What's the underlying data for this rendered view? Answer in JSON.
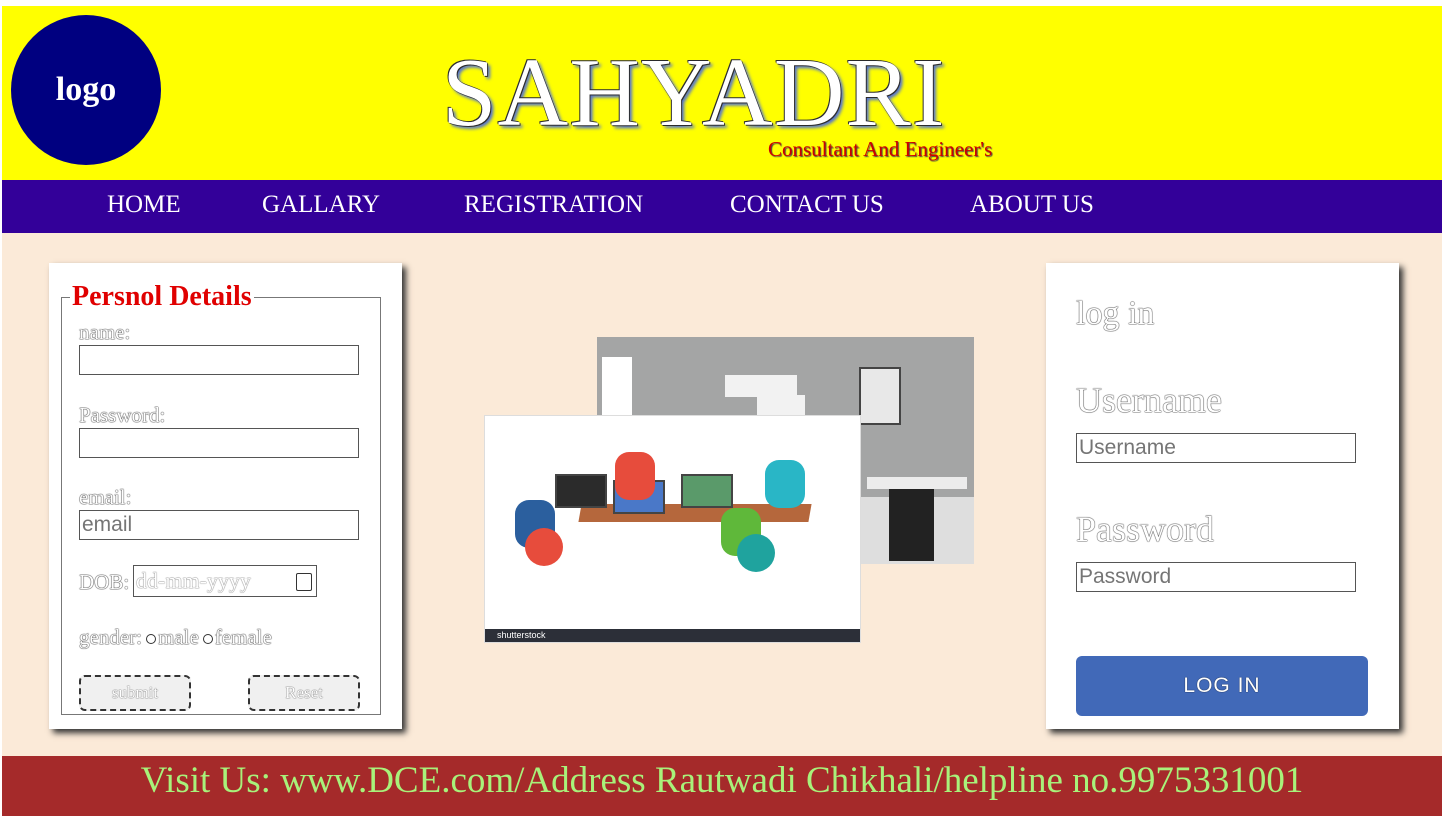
{
  "header": {
    "logo_text": "logo",
    "brand": "SAHYADRI",
    "tagline": "Consultant And Engineer's"
  },
  "nav": {
    "items": [
      "HOME",
      "GALLARY",
      "REGISTRATION",
      "CONTACT US",
      "ABOUT US"
    ]
  },
  "registration": {
    "legend": "Persnol Details",
    "name_label": "name:",
    "name_value": "",
    "password_label": "Password:",
    "password_value": "",
    "email_label": "email:",
    "email_placeholder": "email",
    "dob_label": "DOB:",
    "dob_placeholder": "dd-mm-yyyy",
    "gender_label": "gender:",
    "gender_options": [
      "male",
      "female"
    ],
    "submit_label": "submit",
    "reset_label": "Reset"
  },
  "gallery": {
    "team_image_caption": "shutterstock"
  },
  "login": {
    "title": "log in",
    "username_label": "Username",
    "username_placeholder": "Username",
    "password_label": "Password",
    "password_placeholder": "Password",
    "button_label": "LOG IN"
  },
  "footer": {
    "text": "Visit Us: www.DCE.com/Address Rautwadi Chikhali/helpline no.9975331001"
  },
  "colors": {
    "header_bg": "#ffff00",
    "logo_bg": "#000080",
    "nav_bg": "#330099",
    "main_bg": "#fbead8",
    "legend_color": "#e00000",
    "login_button": "#4169b8",
    "footer_bg": "#a52a2a",
    "footer_text": "#a8f27a"
  }
}
